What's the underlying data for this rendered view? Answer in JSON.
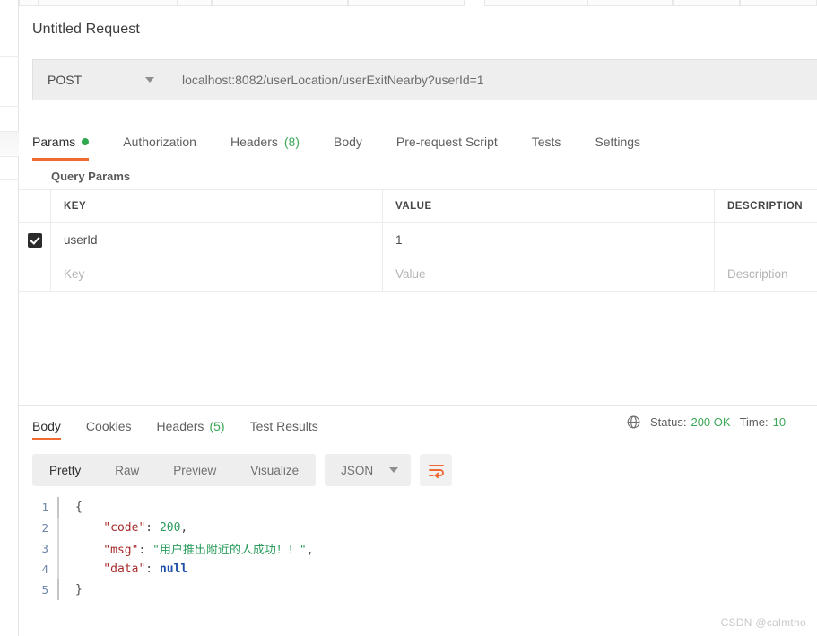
{
  "window": {
    "watermark": "CSDN @calmtho"
  },
  "request": {
    "title": "Untitled Request",
    "method": "POST",
    "url": "localhost:8082/userLocation/userExitNearby?userId=1",
    "tabs": [
      {
        "label": "Params",
        "badge": "",
        "dot": true,
        "active": true
      },
      {
        "label": "Authorization",
        "badge": "",
        "dot": false,
        "active": false
      },
      {
        "label": "Headers",
        "badge": "(8)",
        "dot": false,
        "active": false
      },
      {
        "label": "Body",
        "badge": "",
        "dot": false,
        "active": false
      },
      {
        "label": "Pre-request Script",
        "badge": "",
        "dot": false,
        "active": false
      },
      {
        "label": "Tests",
        "badge": "",
        "dot": false,
        "active": false
      },
      {
        "label": "Settings",
        "badge": "",
        "dot": false,
        "active": false
      }
    ]
  },
  "query_params": {
    "section_label": "Query Params",
    "columns": {
      "key": "KEY",
      "value": "VALUE",
      "description": "DESCRIPTION"
    },
    "rows": [
      {
        "checked": true,
        "key": "userId",
        "value": "1",
        "description": ""
      }
    ],
    "placeholder_row": {
      "key": "Key",
      "value": "Value",
      "description": "Description"
    }
  },
  "response": {
    "tabs": [
      {
        "label": "Body",
        "badge": "",
        "active": true
      },
      {
        "label": "Cookies",
        "badge": "",
        "active": false
      },
      {
        "label": "Headers",
        "badge": "(5)",
        "active": false
      },
      {
        "label": "Test Results",
        "badge": "",
        "active": false
      }
    ],
    "status_label": "Status:",
    "status_value": "200 OK",
    "time_label": "Time:",
    "time_value": "10",
    "format_tabs": [
      {
        "label": "Pretty",
        "active": true
      },
      {
        "label": "Raw",
        "active": false
      },
      {
        "label": "Preview",
        "active": false
      },
      {
        "label": "Visualize",
        "active": false
      }
    ],
    "language": "JSON",
    "body_lines": [
      {
        "n": "1",
        "tokens": [
          {
            "t": "punc",
            "s": "{"
          }
        ]
      },
      {
        "n": "2",
        "tokens": [
          {
            "t": "key",
            "s": "    \"code\""
          },
          {
            "t": "punc",
            "s": ": "
          },
          {
            "t": "num",
            "s": "200"
          },
          {
            "t": "punc",
            "s": ","
          }
        ]
      },
      {
        "n": "3",
        "tokens": [
          {
            "t": "key",
            "s": "    \"msg\""
          },
          {
            "t": "punc",
            "s": ": "
          },
          {
            "t": "str",
            "s": "\"用户推出附近的人成功！！\""
          },
          {
            "t": "punc",
            "s": ","
          }
        ]
      },
      {
        "n": "4",
        "tokens": [
          {
            "t": "key",
            "s": "    \"data\""
          },
          {
            "t": "punc",
            "s": ": "
          },
          {
            "t": "null",
            "s": "null"
          }
        ]
      },
      {
        "n": "5",
        "tokens": [
          {
            "t": "punc",
            "s": "}"
          }
        ]
      }
    ]
  },
  "colors": {
    "accent": "#ef6b33",
    "success": "#3aa757",
    "param_dot": "#2fa84f"
  }
}
